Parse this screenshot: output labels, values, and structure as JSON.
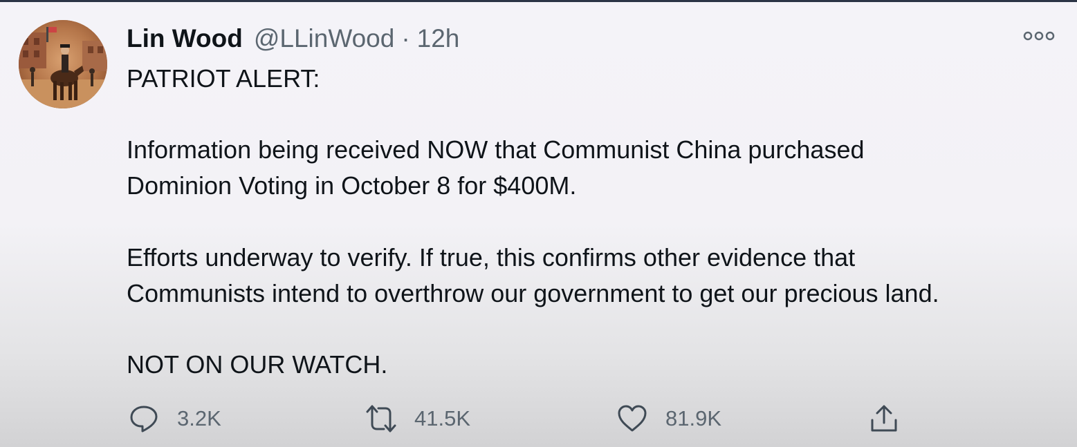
{
  "author": {
    "name": "Lin Wood",
    "handle": "@LLinWood",
    "separator": "·",
    "time": "12h"
  },
  "tweet": {
    "lines": [
      "PATRIOT ALERT:",
      "Information being received NOW that Communist China purchased",
      "Dominion Voting in October 8 for $400M.",
      "Efforts underway to verify. If true, this confirms other evidence that",
      "Communists intend to overthrow our government to get our precious land.",
      "NOT ON OUR WATCH."
    ]
  },
  "actions": {
    "reply_count": "3.2K",
    "retweet_count": "41.5K",
    "like_count": "81.9K"
  },
  "icons": {
    "avatar": "avatar-image",
    "more": "more-options-icon",
    "reply": "reply-icon",
    "retweet": "retweet-icon",
    "like": "like-icon",
    "share": "share-icon"
  },
  "colors": {
    "text_primary": "#0f1419",
    "text_secondary": "#5b6670",
    "top_bar": "#2b3445"
  }
}
